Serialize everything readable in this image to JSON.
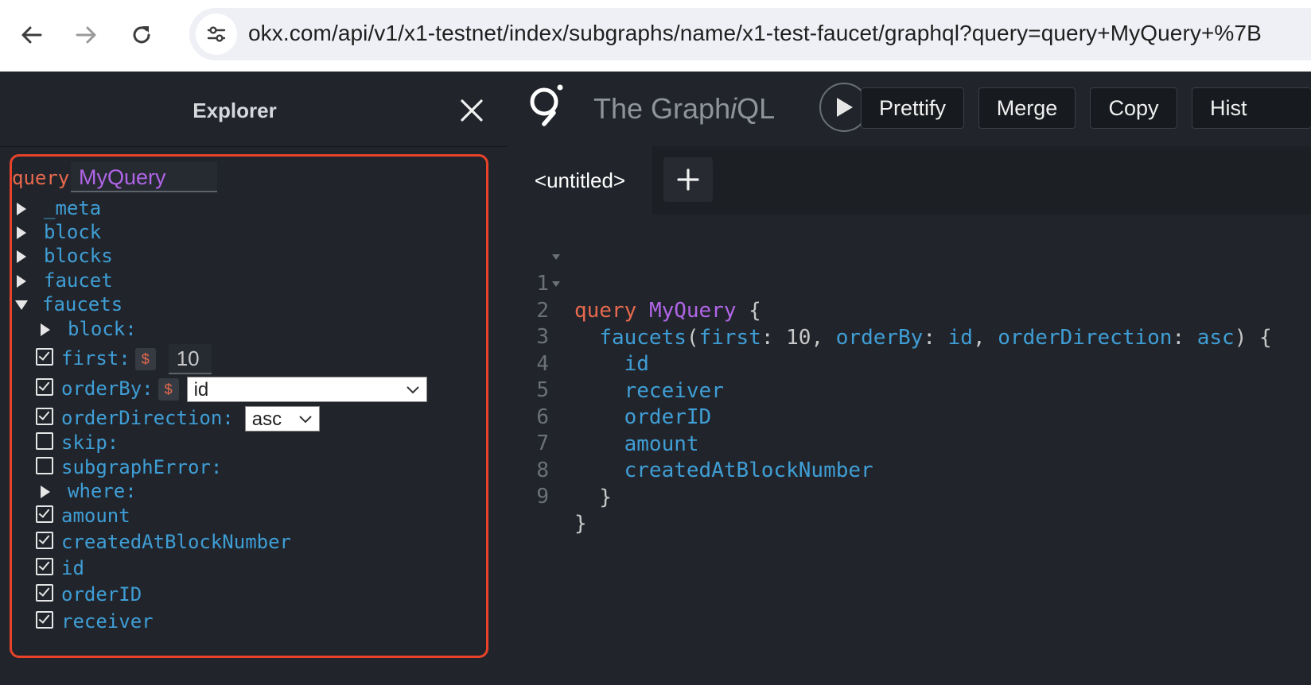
{
  "browser": {
    "url": "okx.com/api/v1/x1-testnet/index/subgraphs/name/x1-test-faucet/graphql?query=query+MyQuery+%7B"
  },
  "explorer": {
    "title": "Explorer",
    "query_keyword": "query",
    "operation_name": "MyQuery",
    "root_fields": [
      "_meta",
      "block",
      "blocks",
      "faucet",
      "faucets"
    ],
    "args": {
      "block": "block:",
      "first": "first:",
      "first_value": "10",
      "orderBy": "orderBy:",
      "orderBy_value": "id",
      "orderDirection": "orderDirection:",
      "orderDirection_value": "asc",
      "skip": "skip:",
      "subgraphError": "subgraphError:",
      "where": "where:"
    },
    "dollar": "$",
    "sub_fields": [
      "amount",
      "createdAtBlockNumber",
      "id",
      "orderID",
      "receiver"
    ]
  },
  "graphiql": {
    "title_prefix": "The Graph",
    "title_italic": "i",
    "title_suffix": "QL",
    "buttons": {
      "prettify": "Prettify",
      "merge": "Merge",
      "copy": "Copy",
      "history": "Hist"
    },
    "tab_label": "<untitled>"
  },
  "editor": {
    "line_numbers": [
      "1",
      "2",
      "3",
      "4",
      "5",
      "6",
      "7",
      "8",
      "9"
    ],
    "l1_kw": "query",
    "l1_name": "MyQuery",
    "l1_brace": "{",
    "l2_field": "faucets",
    "l2_arg1": "first",
    "l2_val1": "10",
    "l2_arg2": "orderBy",
    "l2_val2": "id",
    "l2_arg3": "orderDirection",
    "l2_val3": "asc",
    "fields": [
      "id",
      "receiver",
      "orderID",
      "amount",
      "createdAtBlockNumber"
    ],
    "close_inner": "}",
    "close_outer": "}"
  },
  "colors": {
    "accent_border": "#e8432a",
    "keyword": "#e8694e",
    "operation_name": "#b165e8",
    "field": "#3f9ed6"
  }
}
